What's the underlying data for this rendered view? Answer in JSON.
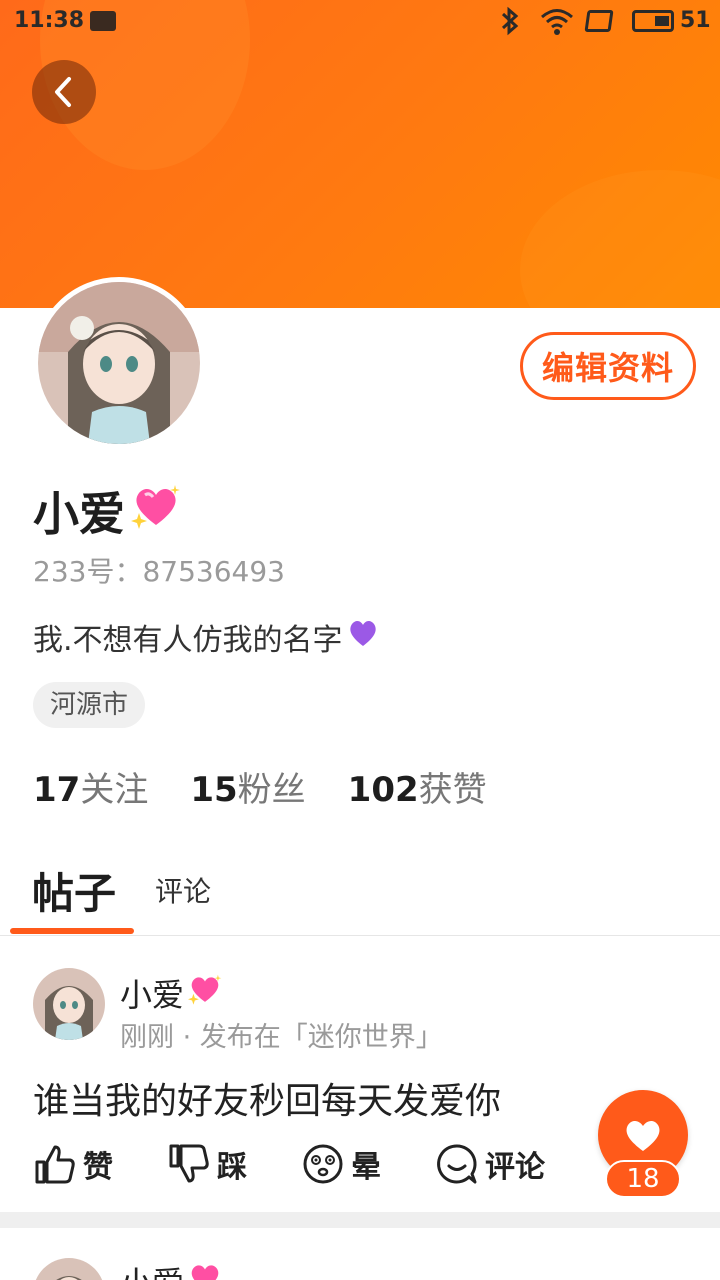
{
  "status_bar": {
    "time": "11:38",
    "battery": "51"
  },
  "profile": {
    "name": "小爱",
    "user_id": "233号：87536493",
    "bio": "我.不想有人仿我的名字",
    "location": "河源市",
    "edit_button": "编辑资料"
  },
  "stats": [
    {
      "num": "17",
      "label": "关注"
    },
    {
      "num": "15",
      "label": "粉丝"
    },
    {
      "num": "102",
      "label": "获赞"
    }
  ],
  "tabs": {
    "posts": "帖子",
    "comments": "评论"
  },
  "post": {
    "author": "小爱",
    "meta": "刚刚 · 发布在「迷你世界」",
    "text": "谁当我的好友秒回每天发爱你",
    "actions": {
      "like": "赞",
      "dislike": "踩",
      "dizzy": "晕",
      "comment": "评论"
    },
    "like_count": "18"
  },
  "post2": {
    "author": "小爱"
  },
  "colors": {
    "accent": "#ff5a1a",
    "header": "#ff7a10"
  },
  "icons": [
    "back-icon",
    "bluetooth-icon",
    "wifi-icon",
    "battery-icon",
    "sparkling-heart-icon",
    "purple-heart-icon",
    "thumbs-up-icon",
    "thumbs-down-icon",
    "dizzy-face-icon",
    "comment-bubble-icon",
    "heart-icon"
  ]
}
